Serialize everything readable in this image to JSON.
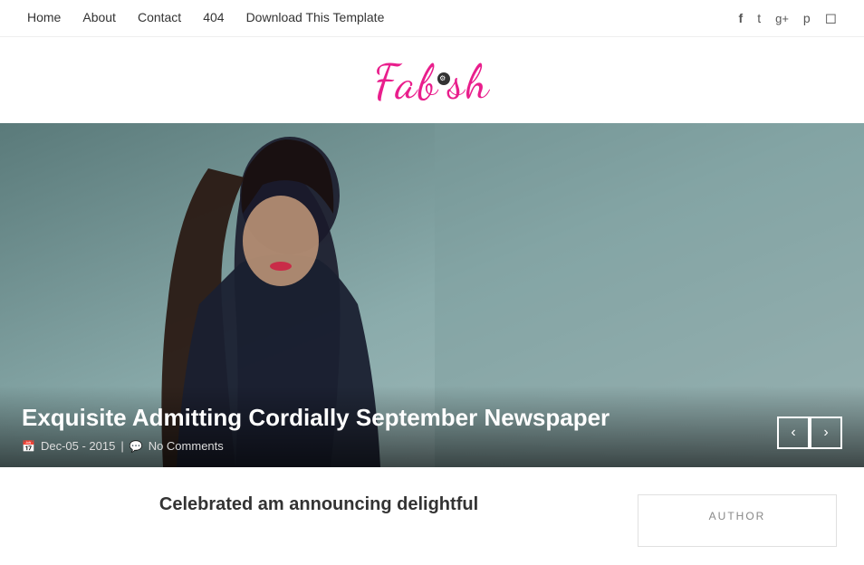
{
  "nav": {
    "links": [
      {
        "id": "home",
        "label": "Home",
        "url": "#"
      },
      {
        "id": "about",
        "label": "About",
        "url": "#"
      },
      {
        "id": "contact",
        "label": "Contact",
        "url": "#"
      },
      {
        "id": "404",
        "label": "404",
        "url": "#"
      },
      {
        "id": "download",
        "label": "Download This Template",
        "url": "#"
      }
    ]
  },
  "social": {
    "icons": [
      {
        "id": "facebook",
        "symbol": "f",
        "label": "Facebook"
      },
      {
        "id": "twitter",
        "symbol": "𝕥",
        "label": "Twitter"
      },
      {
        "id": "google-plus",
        "symbol": "g+",
        "label": "Google Plus"
      },
      {
        "id": "pinterest",
        "symbol": "p",
        "label": "Pinterest"
      },
      {
        "id": "instagram",
        "symbol": "◻",
        "label": "Instagram"
      }
    ]
  },
  "logo": {
    "text_before": "Fab",
    "text_after": "sh",
    "full_text": "Fabish",
    "icon_char": "⚙"
  },
  "hero": {
    "title": "Exquisite Admitting Cordially September Newspaper",
    "date": "Dec-05 - 2015",
    "comments": "No Comments",
    "prev_label": "‹",
    "next_label": "›"
  },
  "article": {
    "teaser": "Celebrated am announcing delightful"
  },
  "sidebar": {
    "author_heading": "AUTHOR"
  }
}
